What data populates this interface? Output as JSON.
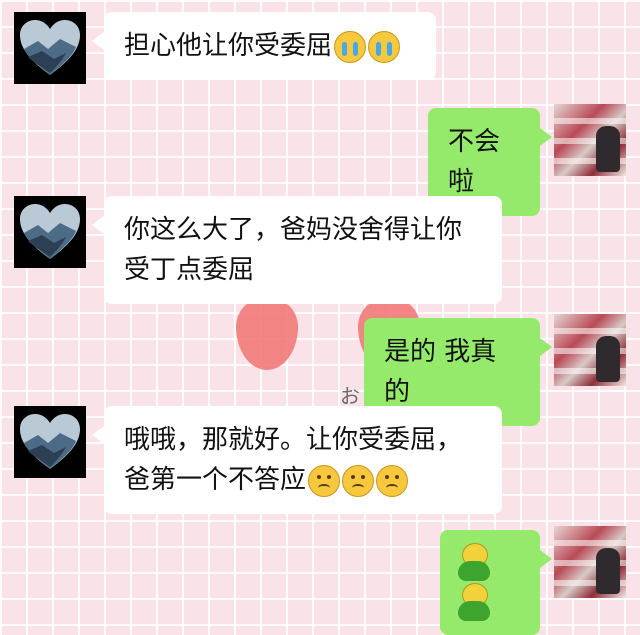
{
  "messages": [
    {
      "side": "left",
      "text": "担心他让你受委屈",
      "emojis": [
        "crying-face",
        "crying-face"
      ]
    },
    {
      "side": "right",
      "text": "不会啦"
    },
    {
      "side": "left",
      "text_line1": "你这么大了，爸妈没舍得让你",
      "text_line2": "受丁点委屈"
    },
    {
      "side": "right",
      "text": "是的 我真的"
    },
    {
      "side": "left",
      "text_line1": "哦哦，那就好。让你受委屈，",
      "text_line2": "爸第一个不答应",
      "emojis": [
        "worried-face",
        "worried-face",
        "worried-face"
      ]
    },
    {
      "side": "right",
      "emojis": [
        "frog-emoji",
        "frog-emoji"
      ]
    }
  ],
  "background": {
    "deco_text": "おはよう!",
    "colors": {
      "pink": "#f9e3e8",
      "grid": "#ffffff",
      "green_bubble": "#95ea6b",
      "white_bubble": "#ffffff"
    }
  }
}
